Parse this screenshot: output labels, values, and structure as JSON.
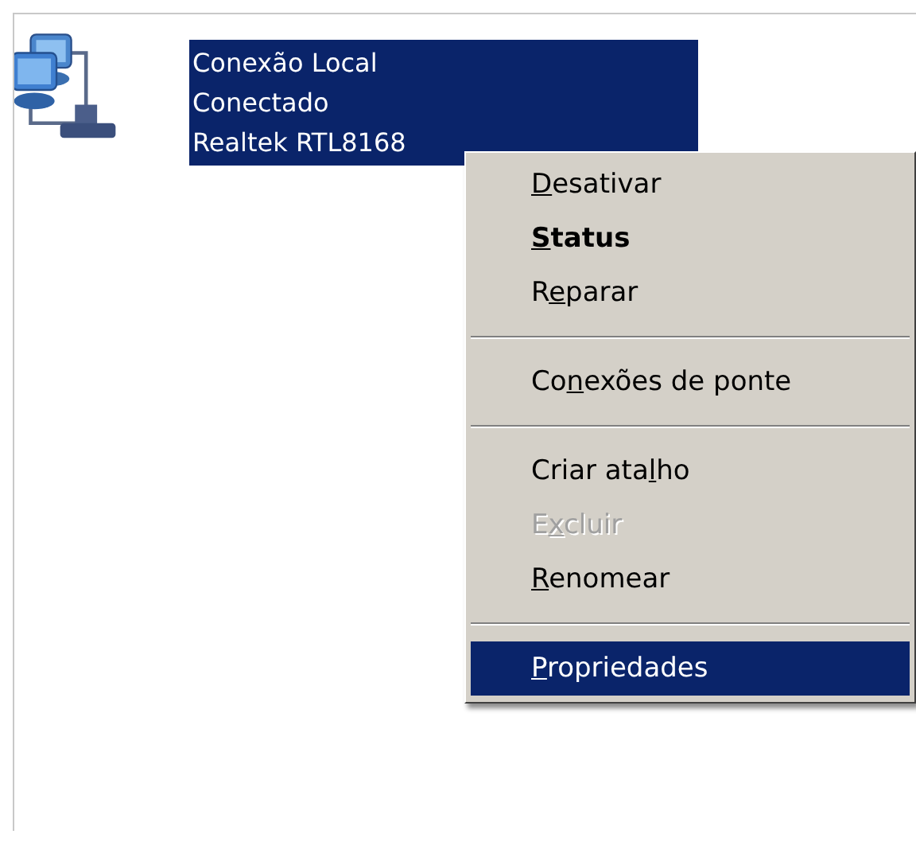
{
  "connection": {
    "lines": [
      "Conexão Local",
      "Conectado",
      "Realtek RTL8168"
    ],
    "selected": true
  },
  "context_menu": {
    "items": [
      {
        "kind": "item",
        "label": [
          {
            "text": "D",
            "underlined": true
          },
          {
            "text": "esativar",
            "underlined": false
          }
        ],
        "default": false,
        "disabled": false,
        "selected": false
      },
      {
        "kind": "item",
        "label": [
          {
            "text": "S",
            "underlined": true
          },
          {
            "text": "tatus",
            "underlined": false
          }
        ],
        "default": true,
        "disabled": false,
        "selected": false
      },
      {
        "kind": "item",
        "label": [
          {
            "text": "R",
            "underlined": false
          },
          {
            "text": "e",
            "underlined": true
          },
          {
            "text": "parar",
            "underlined": false
          }
        ],
        "default": false,
        "disabled": false,
        "selected": false
      },
      {
        "kind": "separator"
      },
      {
        "kind": "item",
        "label": [
          {
            "text": "Co",
            "underlined": false
          },
          {
            "text": "n",
            "underlined": true
          },
          {
            "text": "exões de ponte",
            "underlined": false
          }
        ],
        "default": false,
        "disabled": false,
        "selected": false
      },
      {
        "kind": "separator"
      },
      {
        "kind": "item",
        "label": [
          {
            "text": "Criar ata",
            "underlined": false
          },
          {
            "text": "l",
            "underlined": true
          },
          {
            "text": "ho",
            "underlined": false
          }
        ],
        "default": false,
        "disabled": false,
        "selected": false
      },
      {
        "kind": "item",
        "label": [
          {
            "text": "E",
            "underlined": false
          },
          {
            "text": "x",
            "underlined": true
          },
          {
            "text": "cluir",
            "underlined": false
          }
        ],
        "default": false,
        "disabled": true,
        "selected": false
      },
      {
        "kind": "item",
        "label": [
          {
            "text": "R",
            "underlined": true
          },
          {
            "text": "enomear",
            "underlined": false
          }
        ],
        "default": false,
        "disabled": false,
        "selected": false
      },
      {
        "kind": "separator"
      },
      {
        "kind": "item",
        "label": [
          {
            "text": "P",
            "underlined": true
          },
          {
            "text": "ropriedades",
            "underlined": false
          }
        ],
        "default": false,
        "disabled": false,
        "selected": true
      }
    ]
  }
}
